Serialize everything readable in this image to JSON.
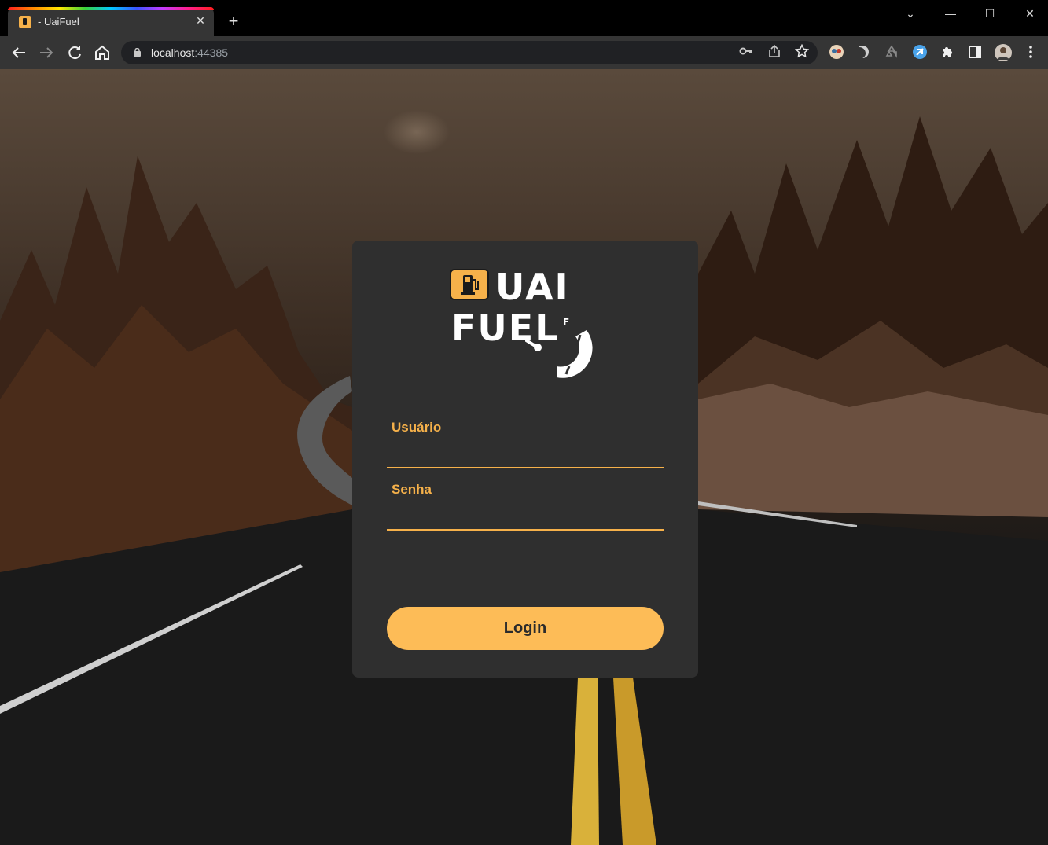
{
  "browser": {
    "tab_title": "- UaiFuel",
    "tab_close": "✕",
    "new_tab": "+",
    "url_host": "localhost",
    "url_port": ":44385",
    "window_controls": {
      "minimize": "—",
      "maximize": "☐",
      "close": "✕",
      "tab_search": "⌄"
    }
  },
  "logo": {
    "line1": "UAI",
    "line2": "FUEL",
    "gauge_f": "F",
    "gauge_e": "E"
  },
  "login_form": {
    "username_label": "Usuário",
    "password_label": "Senha",
    "submit_label": "Login",
    "username_value": "",
    "password_value": ""
  },
  "colors": {
    "accent": "#f6b14a",
    "button": "#fdbc57",
    "card": "#2f2f2f",
    "chrome": "#353535",
    "omnibox": "#202124"
  }
}
